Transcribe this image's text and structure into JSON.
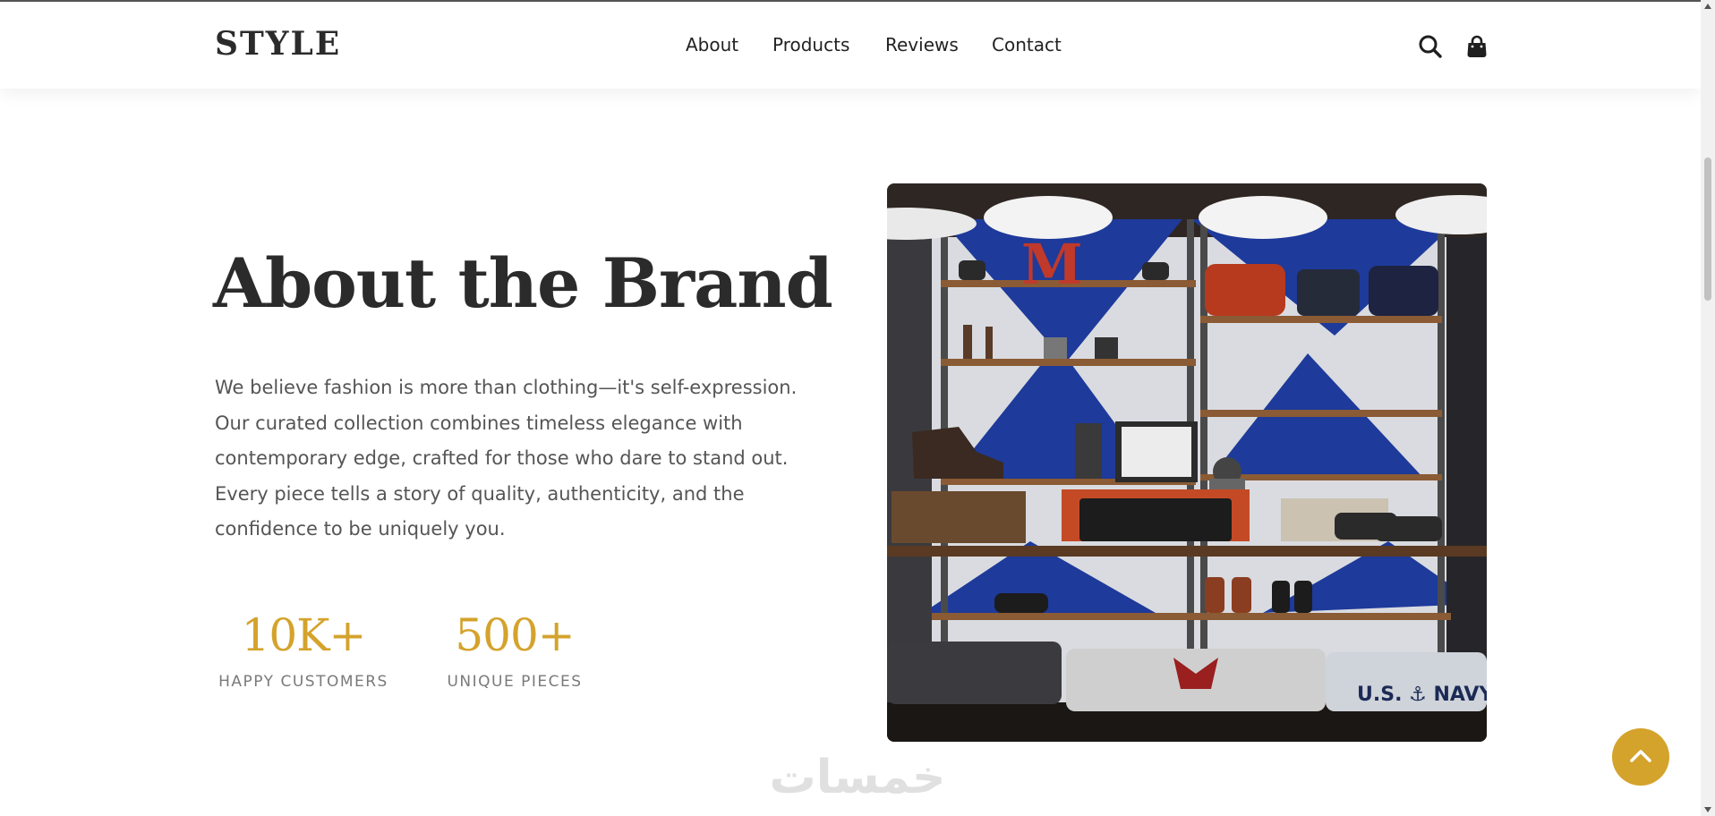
{
  "header": {
    "brand": "STYLE",
    "nav": [
      "About",
      "Products",
      "Reviews",
      "Contact"
    ],
    "icons": [
      "search-icon",
      "shopping-bag-icon"
    ]
  },
  "about": {
    "title": "About the Brand",
    "description": "We believe fashion is more than clothing—it's self-expression. Our curated collection combines timeless elegance with contemporary edge, crafted for those who dare to stand out. Every piece tells a story of quality, authenticity, and the confidence to be uniquely you.",
    "stats": [
      {
        "value": "10K+",
        "label": "HAPPY CUSTOMERS"
      },
      {
        "value": "500+",
        "label": "UNIQUE PIECES"
      }
    ],
    "image_alt_content": "clothing store shelves with shoes, bags and folded garments",
    "image_text": [
      "M",
      "U.S. ⚓ NAVY"
    ]
  },
  "watermark": "خمسات",
  "back_to_top_icon": "chevron-up-icon",
  "colors": {
    "accent": "#d4a32c",
    "heading": "#2b2b2b",
    "body_text": "#555555",
    "muted": "#7a7a7a"
  }
}
